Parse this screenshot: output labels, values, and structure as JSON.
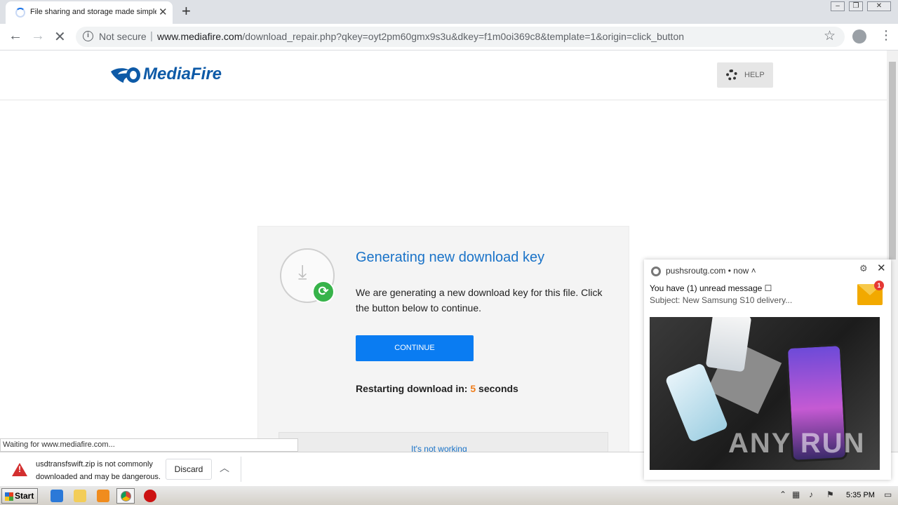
{
  "browser": {
    "tab_title": "File sharing and storage made simple",
    "not_secure_label": "Not secure",
    "url_domain": "www.mediafire.com",
    "url_path": "/download_repair.php?qkey=oyt2pm60gmx9s3u&dkey=f1m0oi369c8&template=1&origin=click_button",
    "status_text": "Waiting for www.mediafire.com..."
  },
  "site": {
    "logo_text": "MediaFire",
    "help_label": "HELP"
  },
  "card": {
    "title": "Generating new download key",
    "description": "We are generating a new download key for this file. Click the button below to continue.",
    "continue_label": "CONTINUE",
    "restart_prefix": "Restarting download in:",
    "restart_count": "5",
    "restart_suffix": "seconds",
    "not_working_label": "It's not working"
  },
  "download_shelf": {
    "warning_text": "usdtransfswift.zip is not commonly downloaded and may be dangerous.",
    "discard_label": "Discard"
  },
  "notification": {
    "source": "pushsroutg.com",
    "time": "now",
    "title": "You have (1) unread message",
    "body": "Subject: New Samsung S10 delivery...",
    "badge_count": "1",
    "watermark": "ANY RUN"
  },
  "taskbar": {
    "start_label": "Start",
    "clock": "5:35 PM"
  },
  "colors": {
    "accent_blue": "#0a7cf2",
    "mediafire_blue": "#0e5aa7",
    "countdown_orange": "#ef7d1a",
    "warning_red": "#d32f2f"
  }
}
